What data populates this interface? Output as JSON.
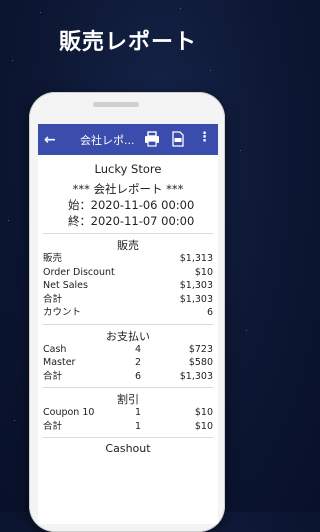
{
  "headline": "販売レポート",
  "appbar": {
    "title": "会社レポ..."
  },
  "receipt": {
    "store": "Lucky Store",
    "report_title": "*** 会社レポート ***",
    "start": {
      "label": "始：",
      "value": "2020-11-06 00:00"
    },
    "end": {
      "label": "終：",
      "value": "2020-11-07 00:00"
    },
    "sales": {
      "title": "販売",
      "rows": [
        {
          "label": "販売",
          "value": "$1,313"
        },
        {
          "label": "Order Discount",
          "value": "$10"
        },
        {
          "label": "Net Sales",
          "value": "$1,303"
        },
        {
          "label": "合計",
          "value": "$1,303"
        },
        {
          "label": "カウント",
          "value": "6"
        }
      ]
    },
    "payments": {
      "title": "お支払い",
      "rows": [
        {
          "label": "Cash",
          "count": "4",
          "amount": "$723"
        },
        {
          "label": "Master",
          "count": "2",
          "amount": "$580"
        },
        {
          "label": "合計",
          "count": "6",
          "amount": "$1,303"
        }
      ]
    },
    "discounts": {
      "title": "割引",
      "rows": [
        {
          "label": "Coupon 10",
          "count": "1",
          "amount": "$10"
        },
        {
          "label": "合計",
          "count": "1",
          "amount": "$10"
        }
      ]
    },
    "cashout": "Cashout"
  },
  "colors": {
    "appbar": "#3a4dad",
    "background": "#0d1733"
  },
  "icons": [
    "back-arrow-icon",
    "print-icon",
    "csv-icon",
    "more-vert-icon"
  ]
}
